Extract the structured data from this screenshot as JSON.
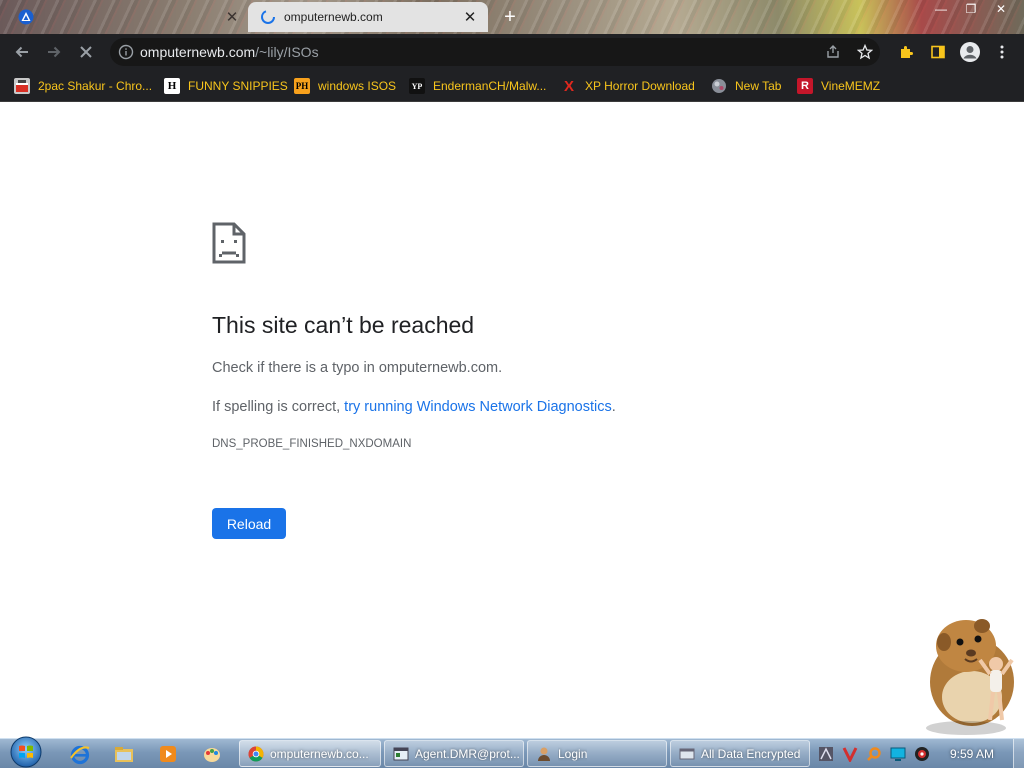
{
  "tabs": [
    {
      "title": "",
      "state": "inactive"
    },
    {
      "title": "omputernewb.com",
      "state": "active-loading"
    }
  ],
  "window_controls": [
    "minimize",
    "maximize",
    "close"
  ],
  "toolbar": {
    "url_host": "omputernewb.com",
    "url_path": "/~lily/ISOs",
    "icons": [
      "back-icon",
      "forward-icon",
      "stop-loading-icon",
      "info-icon",
      "share-icon",
      "star-icon",
      "extensions-icon",
      "sidebar-icon",
      "profile-icon",
      "menu-icon"
    ]
  },
  "bookmarks": [
    {
      "label": "2pac Shakur - Chro...",
      "icon": "bookmark-2pac-icon",
      "badge": ""
    },
    {
      "label": "FUNNY SNIPPIES",
      "icon": "bookmark-h-icon",
      "badge": "H"
    },
    {
      "label": "windows ISOS",
      "icon": "bookmark-ph-icon",
      "badge": "PH"
    },
    {
      "label": "EndermanCH/Malw...",
      "icon": "bookmark-yp-icon",
      "badge": "YP"
    },
    {
      "label": "XP Horror Download",
      "icon": "bookmark-x-icon",
      "badge": "X"
    },
    {
      "label": "New Tab",
      "icon": "bookmark-globe-icon",
      "badge": ""
    },
    {
      "label": "VineMEMZ",
      "icon": "bookmark-r-icon",
      "badge": "R"
    }
  ],
  "error_page": {
    "title": "This site can’t be reached",
    "line1": "Check if there is a typo in omputernewb.com.",
    "line2_prefix": "If spelling is correct, ",
    "line2_link": "try running Windows Network Diagnostics",
    "line2_suffix": ".",
    "error_code": "DNS_PROBE_FINISHED_NXDOMAIN",
    "reload_label": "Reload"
  },
  "taskbar": {
    "pinned": [
      "ie-icon",
      "explorer-icon",
      "media-player-icon",
      "paint-icon"
    ],
    "tasks": [
      {
        "label": "omputernewb.co...",
        "icon": "chrome-icon",
        "active": true
      },
      {
        "label": "Agent.DMR@prot...",
        "icon": "app-window-icon",
        "active": false
      },
      {
        "label": "Login",
        "icon": "user-icon",
        "active": false
      },
      {
        "label": "All Data Encrypted",
        "icon": "window-icon",
        "active": false
      }
    ],
    "tray_icons": [
      "tray-app-icon",
      "tray-v-icon",
      "tray-search-icon",
      "tray-monitor-icon",
      "tray-record-icon"
    ],
    "clock": "9:59 AM"
  },
  "colors": {
    "chrome_dark": "#202124",
    "bookmark_text": "#f8c51c",
    "link_blue": "#1a73e8",
    "reload_blue": "#1a73e8",
    "taskbar": "#7b98b8"
  }
}
